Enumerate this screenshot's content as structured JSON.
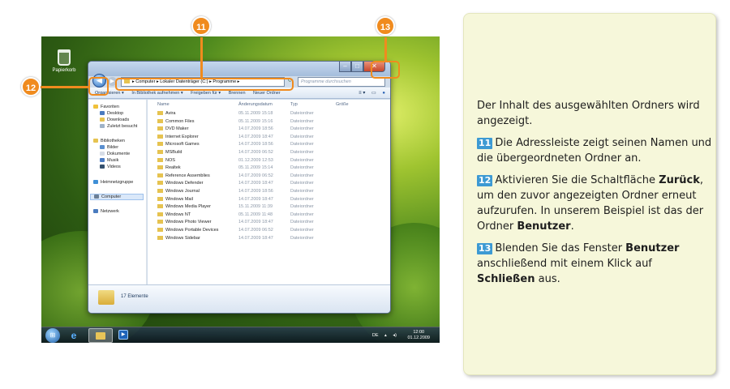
{
  "desktop": {
    "recycle_bin": "Papierkorb"
  },
  "window": {
    "address": [
      "Computer",
      "Lokaler Datenträger (C:)",
      "Programme"
    ],
    "search_placeholder": "Programme durchsuchen",
    "toolbar": [
      "Organisieren ▾",
      "In Bibliothek aufnehmen ▾",
      "Freigeben für ▾",
      "Brennen",
      "Neuer Ordner"
    ],
    "nav": {
      "favorites": "Favoriten",
      "fav_items": [
        "Desktop",
        "Downloads",
        "Zuletzt besucht"
      ],
      "libraries": "Bibliotheken",
      "lib_items": [
        "Bilder",
        "Dokumente",
        "Musik",
        "Videos"
      ],
      "homegroup": "Heimnetzgruppe",
      "computer": "Computer",
      "network": "Netzwerk"
    },
    "columns": {
      "name": "Name",
      "date": "Änderungsdatum",
      "type": "Typ",
      "size": "Größe"
    },
    "rows": [
      {
        "name": "Avira",
        "date": "05.11.2009 15:18",
        "type": "Dateiordner"
      },
      {
        "name": "Common Files",
        "date": "05.11.2009 15:16",
        "type": "Dateiordner"
      },
      {
        "name": "DVD Maker",
        "date": "14.07.2009 18:56",
        "type": "Dateiordner"
      },
      {
        "name": "Internet Explorer",
        "date": "14.07.2009 18:47",
        "type": "Dateiordner"
      },
      {
        "name": "Microsoft Games",
        "date": "14.07.2009 18:56",
        "type": "Dateiordner"
      },
      {
        "name": "MSBuild",
        "date": "14.07.2009 06:52",
        "type": "Dateiordner"
      },
      {
        "name": "NOS",
        "date": "01.12.2009 12:53",
        "type": "Dateiordner"
      },
      {
        "name": "Realtek",
        "date": "05.11.2009 15:14",
        "type": "Dateiordner"
      },
      {
        "name": "Reference Assemblies",
        "date": "14.07.2009 06:52",
        "type": "Dateiordner"
      },
      {
        "name": "Windows Defender",
        "date": "14.07.2009 18:47",
        "type": "Dateiordner"
      },
      {
        "name": "Windows Journal",
        "date": "14.07.2009 18:56",
        "type": "Dateiordner"
      },
      {
        "name": "Windows Mail",
        "date": "14.07.2009 18:47",
        "type": "Dateiordner"
      },
      {
        "name": "Windows Media Player",
        "date": "15.11.2009 11:39",
        "type": "Dateiordner"
      },
      {
        "name": "Windows NT",
        "date": "05.11.2009 11:48",
        "type": "Dateiordner"
      },
      {
        "name": "Windows Photo Viewer",
        "date": "14.07.2009 18:47",
        "type": "Dateiordner"
      },
      {
        "name": "Windows Portable Devices",
        "date": "14.07.2009 06:52",
        "type": "Dateiordner"
      },
      {
        "name": "Windows Sidebar",
        "date": "14.07.2009 18:47",
        "type": "Dateiordner"
      }
    ],
    "status": "17 Elemente"
  },
  "taskbar": {
    "lang": "DE",
    "time": "12:00",
    "date": "01.12.2009"
  },
  "markers": {
    "m11": "11",
    "m12": "12",
    "m13": "13"
  },
  "panel": {
    "intro": "Der Inhalt des ausgewählten Ordners wird angezeigt.",
    "p11": {
      "num": "11",
      "text": "Die Adressleiste zeigt seinen Namen und die übergeordneten Ordner an."
    },
    "p12": {
      "num": "12",
      "text_a": "Aktivieren Sie die Schaltfläche ",
      "bold_a": "Zurück",
      "text_b": ", um den zuvor angezeigten Ordner erneut aufzurufen. In unserem Beispiel ist das der Ordner ",
      "bold_b": "Benutzer",
      "text_c": "."
    },
    "p13": {
      "num": "13",
      "text_a": "Blenden Sie das Fenster ",
      "bold_a": "Benutzer",
      "text_b": " anschließend mit einem Klick auf ",
      "bold_b": "Schließen",
      "text_c": " aus."
    }
  },
  "colors": {
    "accent": "#f08b1e",
    "number_badge": "#3d9ad3",
    "panel_bg": "#f6f7da"
  }
}
